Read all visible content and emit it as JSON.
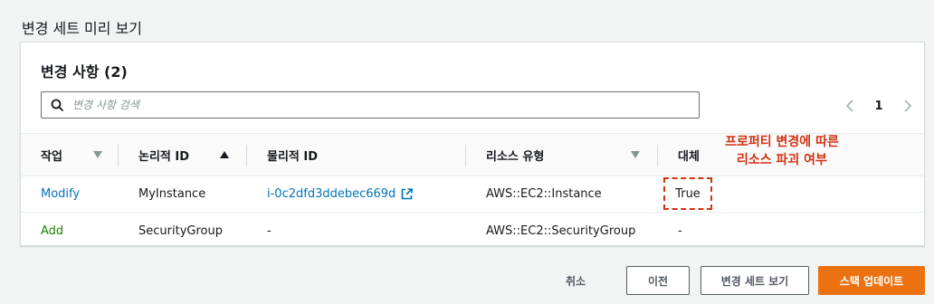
{
  "section": {
    "title": "변경 세트 미리 보기"
  },
  "panel": {
    "title": "변경 사항",
    "count": "(2)",
    "search_placeholder": "변경 사항 검색",
    "pager": {
      "current_page": "1"
    }
  },
  "table": {
    "headers": {
      "action": "작업",
      "logical_id": "논리적 ID",
      "physical_id": "물리적 ID",
      "resource_type": "리소스 유형",
      "replacement": "대체"
    },
    "rows": [
      {
        "action": "Modify",
        "logical_id": "MyInstance",
        "physical_id": "i-0c2dfd3ddebec669d",
        "resource_type": "AWS::EC2::Instance",
        "replacement": "True"
      },
      {
        "action": "Add",
        "logical_id": "SecurityGroup",
        "physical_id": "-",
        "resource_type": "AWS::EC2::SecurityGroup",
        "replacement": "-"
      }
    ]
  },
  "annotation": {
    "line1": "프로퍼티 변경에 따른",
    "line2": "리소스 파괴 여부"
  },
  "footer": {
    "cancel_label": "취소",
    "previous_label": "이전",
    "view_change_set_label": "변경 세트 보기",
    "update_stack_label": "스택 업데이트"
  },
  "colors": {
    "primary_button": "#ec7211",
    "link": "#0073bb",
    "add_action": "#1d8102",
    "annotation": "#d13212"
  }
}
